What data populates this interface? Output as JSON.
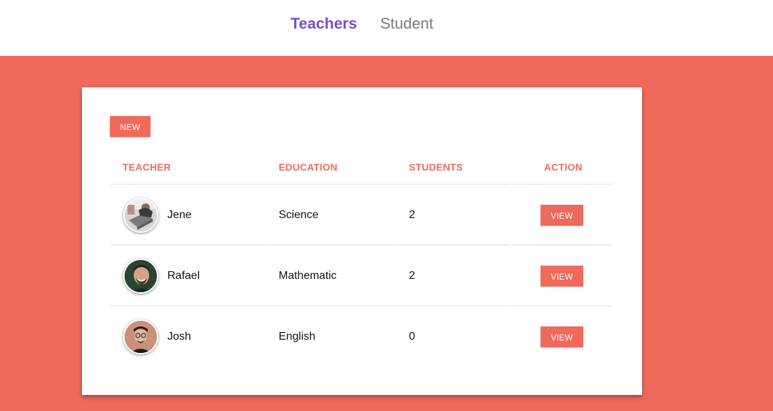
{
  "nav": {
    "teachers_label": "Teachers",
    "student_label": "Student"
  },
  "toolbar": {
    "new_label": "NEW"
  },
  "table": {
    "headers": {
      "teacher": "TEACHER",
      "education": "EDUCATION",
      "students": "STUDENTS",
      "action": "ACTION"
    },
    "rows": [
      {
        "name": "Jene",
        "education": "Science",
        "students": "2",
        "action": "VIEW"
      },
      {
        "name": "Rafael",
        "education": "Mathematic",
        "students": "2",
        "action": "VIEW"
      },
      {
        "name": "Josh",
        "education": "English",
        "students": "0",
        "action": "VIEW"
      }
    ]
  },
  "colors": {
    "accent": "#ef6a5b",
    "nav_active": "#7452c6",
    "nav_inactive": "#7a7a7a"
  }
}
